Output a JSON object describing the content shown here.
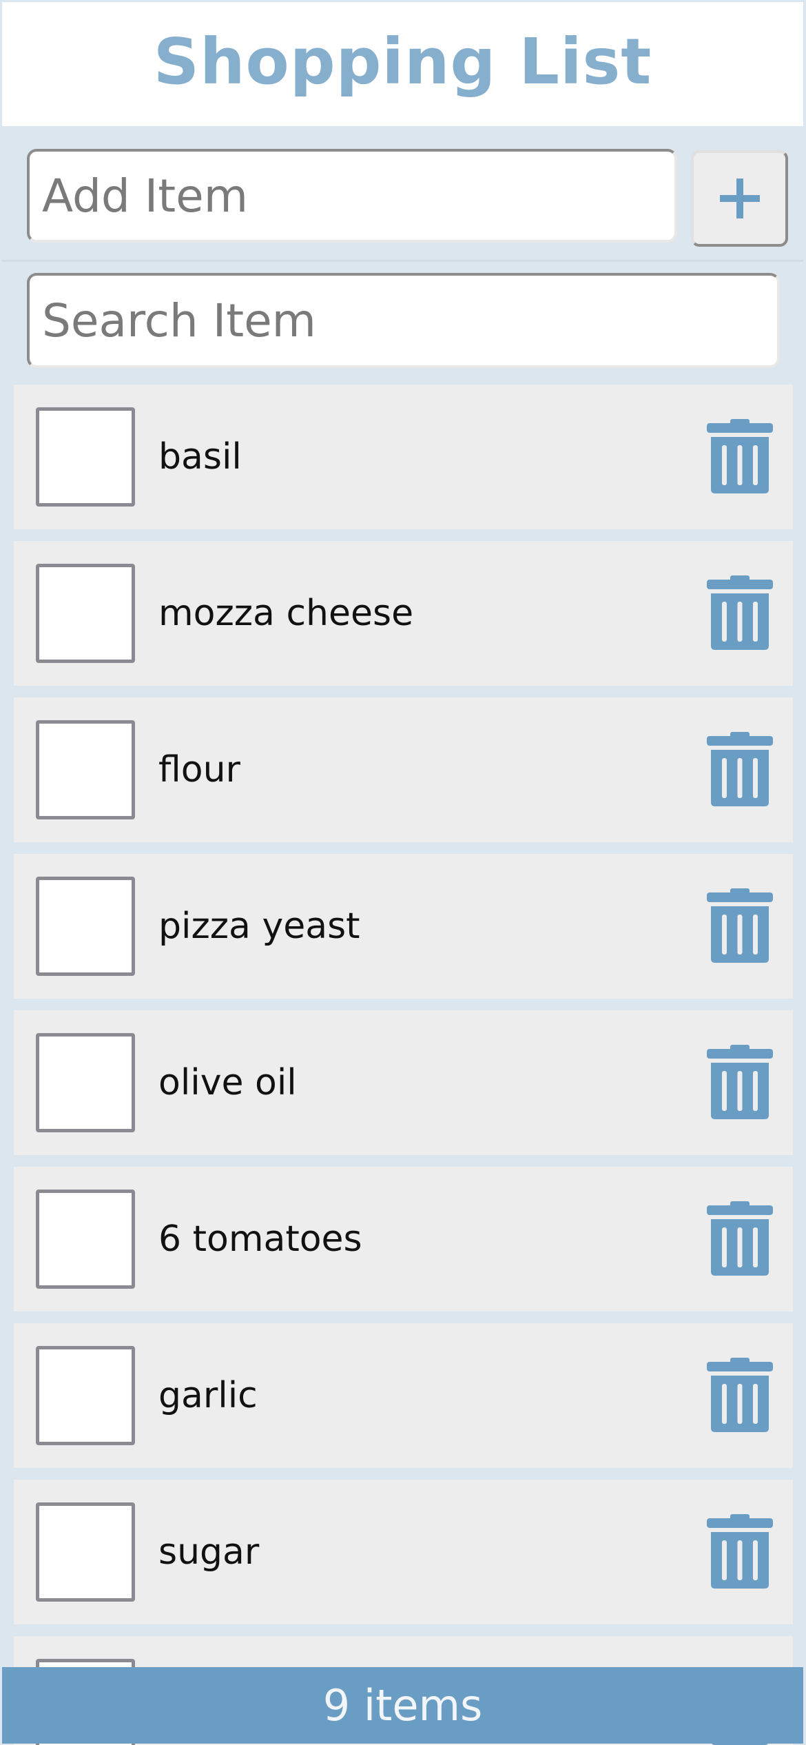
{
  "header": {
    "title": "Shopping List"
  },
  "add_item": {
    "placeholder": "Add Item",
    "button_icon": "plus-icon"
  },
  "search": {
    "placeholder": "Search Item"
  },
  "items": [
    {
      "label": "basil",
      "checked": false
    },
    {
      "label": "mozza cheese",
      "checked": false
    },
    {
      "label": "flour",
      "checked": false
    },
    {
      "label": "pizza yeast",
      "checked": false
    },
    {
      "label": "olive oil",
      "checked": false
    },
    {
      "label": "6 tomatoes",
      "checked": false
    },
    {
      "label": "garlic",
      "checked": false
    },
    {
      "label": "sugar",
      "checked": false
    },
    {
      "label": "",
      "checked": false
    }
  ],
  "footer": {
    "count_text": "9 items"
  },
  "colors": {
    "accent": "#6a9dc3",
    "title": "#86aecd",
    "background": "#dbe6ef",
    "item_background": "#ededed"
  },
  "icons": {
    "delete": "trash-icon"
  }
}
